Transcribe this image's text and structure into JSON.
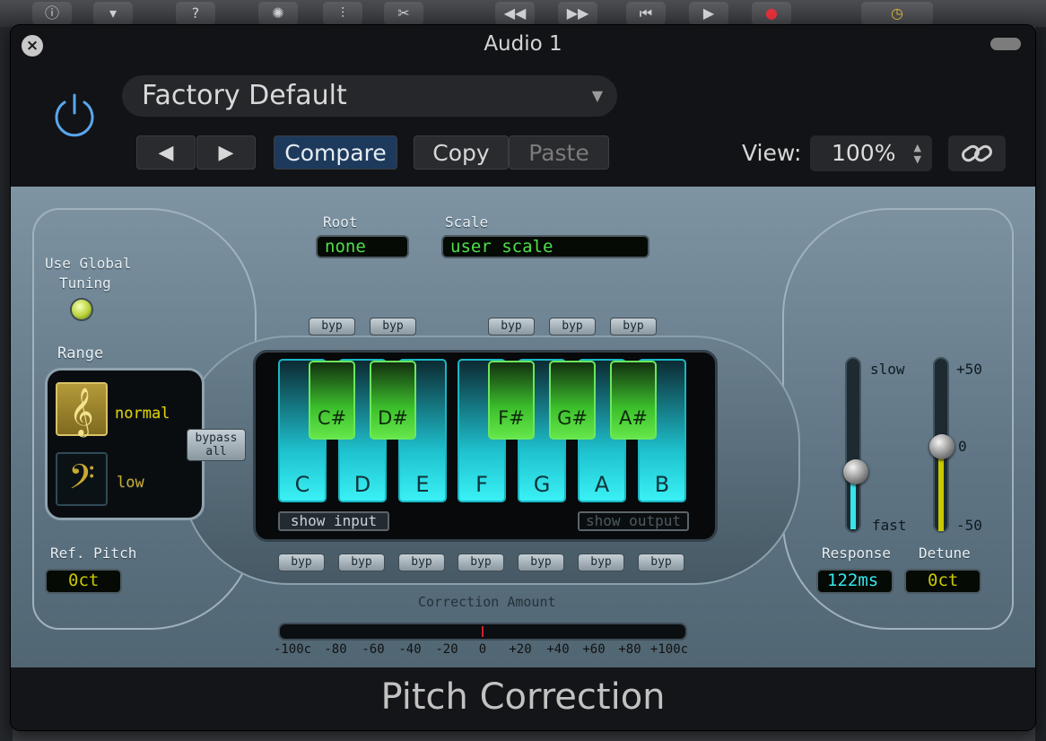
{
  "window": {
    "title": "Audio 1",
    "plugin_name": "Pitch Correction"
  },
  "preset": {
    "name": "Factory Default"
  },
  "toolbar": {
    "prev": "◀",
    "next": "▶",
    "compare": "Compare",
    "copy": "Copy",
    "paste": "Paste",
    "view_label": "View:",
    "view_value": "100%"
  },
  "tuning": {
    "use_global_label_1": "Use Global",
    "use_global_label_2": "Tuning",
    "range_label": "Range",
    "range_high": "normal",
    "range_low": "low",
    "ref_pitch_label": "Ref. Pitch",
    "ref_pitch_value": "0ct"
  },
  "root": {
    "label": "Root",
    "value": "none"
  },
  "scale": {
    "label": "Scale",
    "value": "user scale"
  },
  "keys": {
    "white": [
      "C",
      "D",
      "E",
      "F",
      "G",
      "A",
      "B"
    ],
    "black": [
      "C#",
      "D#",
      "F#",
      "G#",
      "A#"
    ]
  },
  "bypass": {
    "label": "byp",
    "bypass_all_1": "bypass",
    "bypass_all_2": "all"
  },
  "show": {
    "input": "show input",
    "output": "show output"
  },
  "response": {
    "label": "Response",
    "slow": "slow",
    "fast": "fast",
    "value": "122ms"
  },
  "detune": {
    "label": "Detune",
    "top": "+50",
    "mid": "0",
    "bottom": "-50",
    "value": "0ct"
  },
  "correction": {
    "label": "Correction Amount",
    "ticks": [
      "-100c",
      "-80",
      "-60",
      "-40",
      "-20",
      "0",
      "+20",
      "+40",
      "+60",
      "+80",
      "+100c"
    ]
  },
  "colors": {
    "lcd_green": "#4ee04a",
    "accent_cyan": "#36e6ec",
    "accent_yellow": "#c9c800",
    "compare_blue": "#1d3a5c"
  }
}
